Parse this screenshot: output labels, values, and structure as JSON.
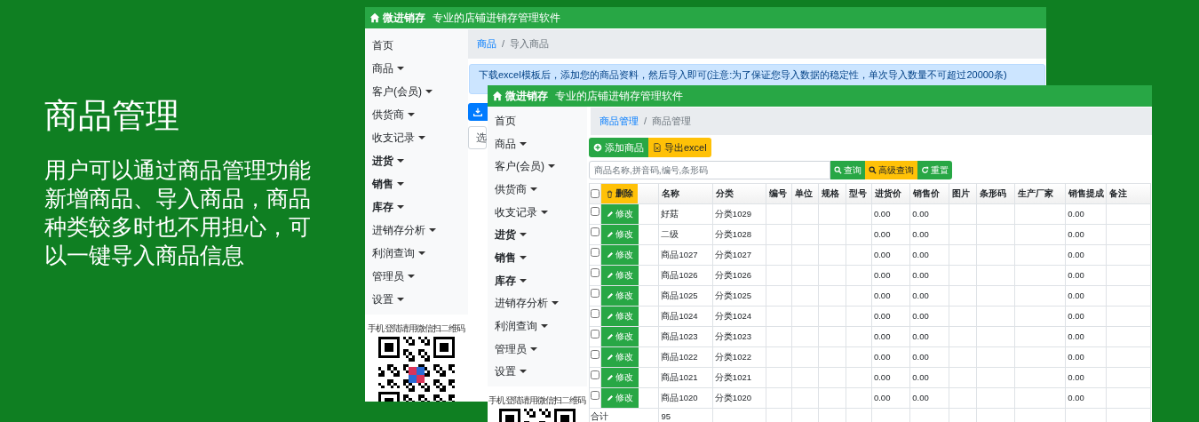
{
  "promo": {
    "title": "商品管理",
    "description": "用户可以通过商品管理功能新增商品、导入商品，商品种类较多时也不用担心，可以一键导入商品信息"
  },
  "back_window": {
    "brand": "微进销存",
    "subtitle": "专业的店铺进销存管理软件",
    "sidebar": [
      {
        "label": "首页",
        "bold": false,
        "has_menu": false
      },
      {
        "label": "商品",
        "bold": false,
        "has_menu": true
      },
      {
        "label": "客户(会员)",
        "bold": false,
        "has_menu": true
      },
      {
        "label": "供货商",
        "bold": false,
        "has_menu": true
      },
      {
        "label": "收支记录",
        "bold": false,
        "has_menu": true
      },
      {
        "label": "进货",
        "bold": true,
        "has_menu": true
      },
      {
        "label": "销售",
        "bold": true,
        "has_menu": true
      },
      {
        "label": "库存",
        "bold": true,
        "has_menu": true
      },
      {
        "label": "进销存分析",
        "bold": false,
        "has_menu": true
      },
      {
        "label": "利润查询",
        "bold": false,
        "has_menu": true
      },
      {
        "label": "管理员",
        "bold": false,
        "has_menu": true
      },
      {
        "label": "设置",
        "bold": false,
        "has_menu": true
      }
    ],
    "qr_caption": "手机登陆请用微信扫二维码",
    "breadcrumb": {
      "items": [
        "商品",
        "导入商品"
      ],
      "separator": "/"
    },
    "notice": "下载excel模板后，添加您的商品资料，然后导入即可(注意:为了保证您导入数据的稳定性，单次导入数量不可超过20000条)",
    "select_value": "选"
  },
  "front_window": {
    "brand": "微进销存",
    "subtitle": "专业的店铺进销存管理软件",
    "sidebar": [
      {
        "label": "首页",
        "bold": false,
        "has_menu": false
      },
      {
        "label": "商品",
        "bold": false,
        "has_menu": true
      },
      {
        "label": "客户(会员)",
        "bold": false,
        "has_menu": true
      },
      {
        "label": "供货商",
        "bold": false,
        "has_menu": true
      },
      {
        "label": "收支记录",
        "bold": false,
        "has_menu": true
      },
      {
        "label": "进货",
        "bold": true,
        "has_menu": true
      },
      {
        "label": "销售",
        "bold": true,
        "has_menu": true
      },
      {
        "label": "库存",
        "bold": true,
        "has_menu": true
      },
      {
        "label": "进销存分析",
        "bold": false,
        "has_menu": true
      },
      {
        "label": "利润查询",
        "bold": false,
        "has_menu": true
      },
      {
        "label": "管理员",
        "bold": false,
        "has_menu": true
      },
      {
        "label": "设置",
        "bold": false,
        "has_menu": true
      }
    ],
    "qr_caption": "手机登陆请用微信扫二维码",
    "breadcrumb": {
      "items": [
        "商品管理",
        "商品管理"
      ],
      "separator": "/"
    },
    "toolbar_buttons": [
      {
        "label": "添加商品",
        "kind": "add"
      },
      {
        "label": "导出excel",
        "kind": "export"
      }
    ],
    "search": {
      "placeholder": "商品名称,拼音码,编号,条形码"
    },
    "search_buttons": [
      {
        "label": "查询",
        "kind": "search"
      },
      {
        "label": "高级查询",
        "kind": "advanced"
      },
      {
        "label": "重置",
        "kind": "reset"
      }
    ],
    "table": {
      "select_all_checked": false,
      "delete_label": "删除",
      "columns": [
        "名称",
        "分类",
        "编号",
        "单位",
        "规格",
        "型号",
        "进货价",
        "销售价",
        "图片",
        "条形码",
        "生产厂家",
        "销售提成",
        "备注"
      ],
      "rows": [
        {
          "checked": false,
          "edit_label": "修改",
          "cells": [
            "好菇",
            "分类1029",
            "",
            "",
            "",
            "",
            "0.00",
            "0.00",
            "",
            "",
            "",
            "0.00",
            ""
          ]
        },
        {
          "checked": false,
          "edit_label": "修改",
          "cells": [
            "二级",
            "分类1028",
            "",
            "",
            "",
            "",
            "0.00",
            "0.00",
            "",
            "",
            "",
            "0.00",
            ""
          ]
        },
        {
          "checked": false,
          "edit_label": "修改",
          "cells": [
            "商品1027",
            "分类1027",
            "",
            "",
            "",
            "",
            "0.00",
            "0.00",
            "",
            "",
            "",
            "0.00",
            ""
          ]
        },
        {
          "checked": false,
          "edit_label": "修改",
          "cells": [
            "商品1026",
            "分类1026",
            "",
            "",
            "",
            "",
            "0.00",
            "0.00",
            "",
            "",
            "",
            "0.00",
            ""
          ]
        },
        {
          "checked": false,
          "edit_label": "修改",
          "cells": [
            "商品1025",
            "分类1025",
            "",
            "",
            "",
            "",
            "0.00",
            "0.00",
            "",
            "",
            "",
            "0.00",
            ""
          ]
        },
        {
          "checked": false,
          "edit_label": "修改",
          "cells": [
            "商品1024",
            "分类1024",
            "",
            "",
            "",
            "",
            "0.00",
            "0.00",
            "",
            "",
            "",
            "0.00",
            ""
          ]
        },
        {
          "checked": false,
          "edit_label": "修改",
          "cells": [
            "商品1023",
            "分类1023",
            "",
            "",
            "",
            "",
            "0.00",
            "0.00",
            "",
            "",
            "",
            "0.00",
            ""
          ]
        },
        {
          "checked": false,
          "edit_label": "修改",
          "cells": [
            "商品1022",
            "分类1022",
            "",
            "",
            "",
            "",
            "0.00",
            "0.00",
            "",
            "",
            "",
            "0.00",
            ""
          ]
        },
        {
          "checked": false,
          "edit_label": "修改",
          "cells": [
            "商品1021",
            "分类1021",
            "",
            "",
            "",
            "",
            "0.00",
            "0.00",
            "",
            "",
            "",
            "0.00",
            ""
          ]
        },
        {
          "checked": false,
          "edit_label": "修改",
          "cells": [
            "商品1020",
            "分类1020",
            "",
            "",
            "",
            "",
            "0.00",
            "0.00",
            "",
            "",
            "",
            "0.00",
            ""
          ]
        }
      ],
      "total": {
        "label": "合计",
        "count": "95"
      }
    }
  }
}
